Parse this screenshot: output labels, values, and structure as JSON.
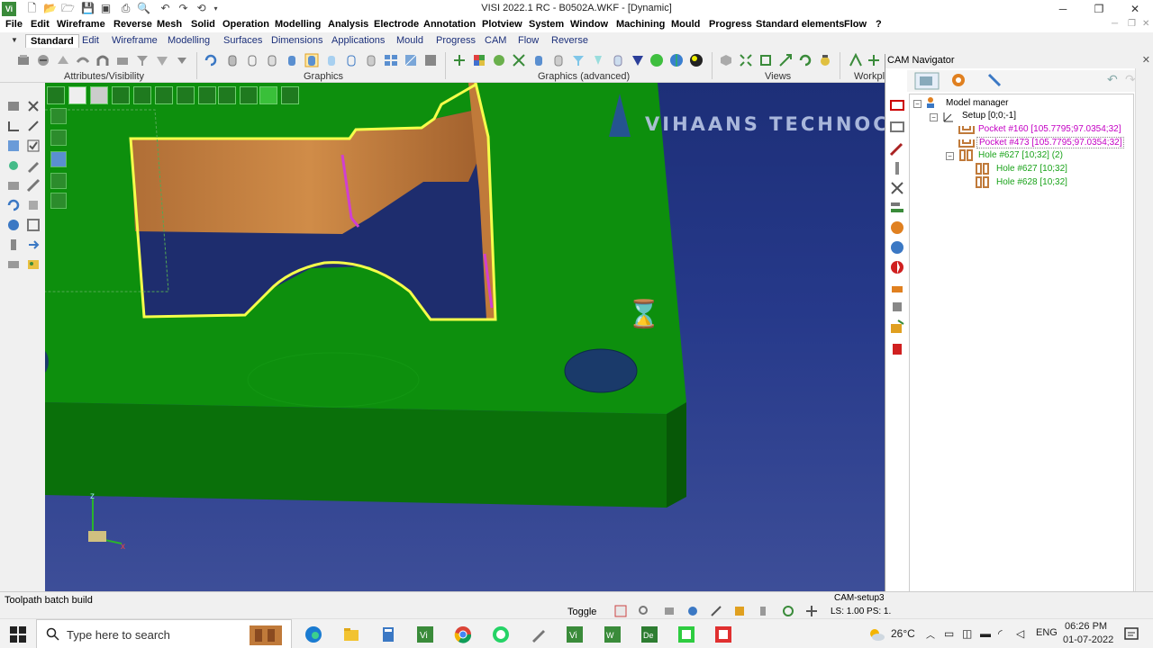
{
  "window": {
    "title": "VISI 2022.1 RC - B0502A.WKF - [Dynamic]",
    "app_badge": "Vi"
  },
  "menu": [
    "File",
    "Edit",
    "Wireframe",
    "Reverse",
    "Mesh",
    "Solid",
    "Operation",
    "Modelling",
    "Analysis",
    "Electrode",
    "Annotation",
    "Plotview",
    "System",
    "Window",
    "Machining",
    "Mould",
    "Progress",
    "Standard elements",
    "Flow",
    "?"
  ],
  "tabs": [
    "Standard",
    "Edit",
    "Wireframe",
    "Modelling",
    "Surfaces",
    "Dimensions",
    "Applications",
    "Mould",
    "Progress",
    "CAM",
    "Flow",
    "Reverse"
  ],
  "active_tab": "Standard",
  "ribbon_groups": [
    "Attributes/Visibility",
    "Graphics",
    "Graphics (advanced)",
    "Views",
    "Workpl"
  ],
  "viewport": {
    "watermark": "VIHAANS TECHNOCRAFT",
    "axis_z": "z",
    "axis_x": "x"
  },
  "cam_navigator": {
    "title": "CAM Navigator",
    "tree": {
      "root": "Model manager",
      "setup": "Setup [0;0;-1]",
      "pocket1": "Pocket #160 [105.7795;97.0354;32]",
      "pocket2": "Pocket #473 [105.7795;97.0354;32]",
      "hole_group": "Hole #627 [10;32] (2)",
      "hole1": "Hole #627 [10;32]",
      "hole2": "Hole #628 [10;32]"
    }
  },
  "status": {
    "message": "Toolpath batch build",
    "toggle": "Toggle",
    "cam_setup": "CAM-setup3",
    "ls": "LS: 1.00 PS: 1."
  },
  "taskbar": {
    "search_placeholder": "Type here to search",
    "weather": "26°C",
    "lang": "ENG",
    "time": "06:26 PM",
    "date": "01-07-2022"
  },
  "colors": {
    "model_green": "#0a8f0a",
    "pocket_orange": "#c8823c",
    "highlight_yellow": "#f5ff4a",
    "bg_blue": "#23378a"
  }
}
